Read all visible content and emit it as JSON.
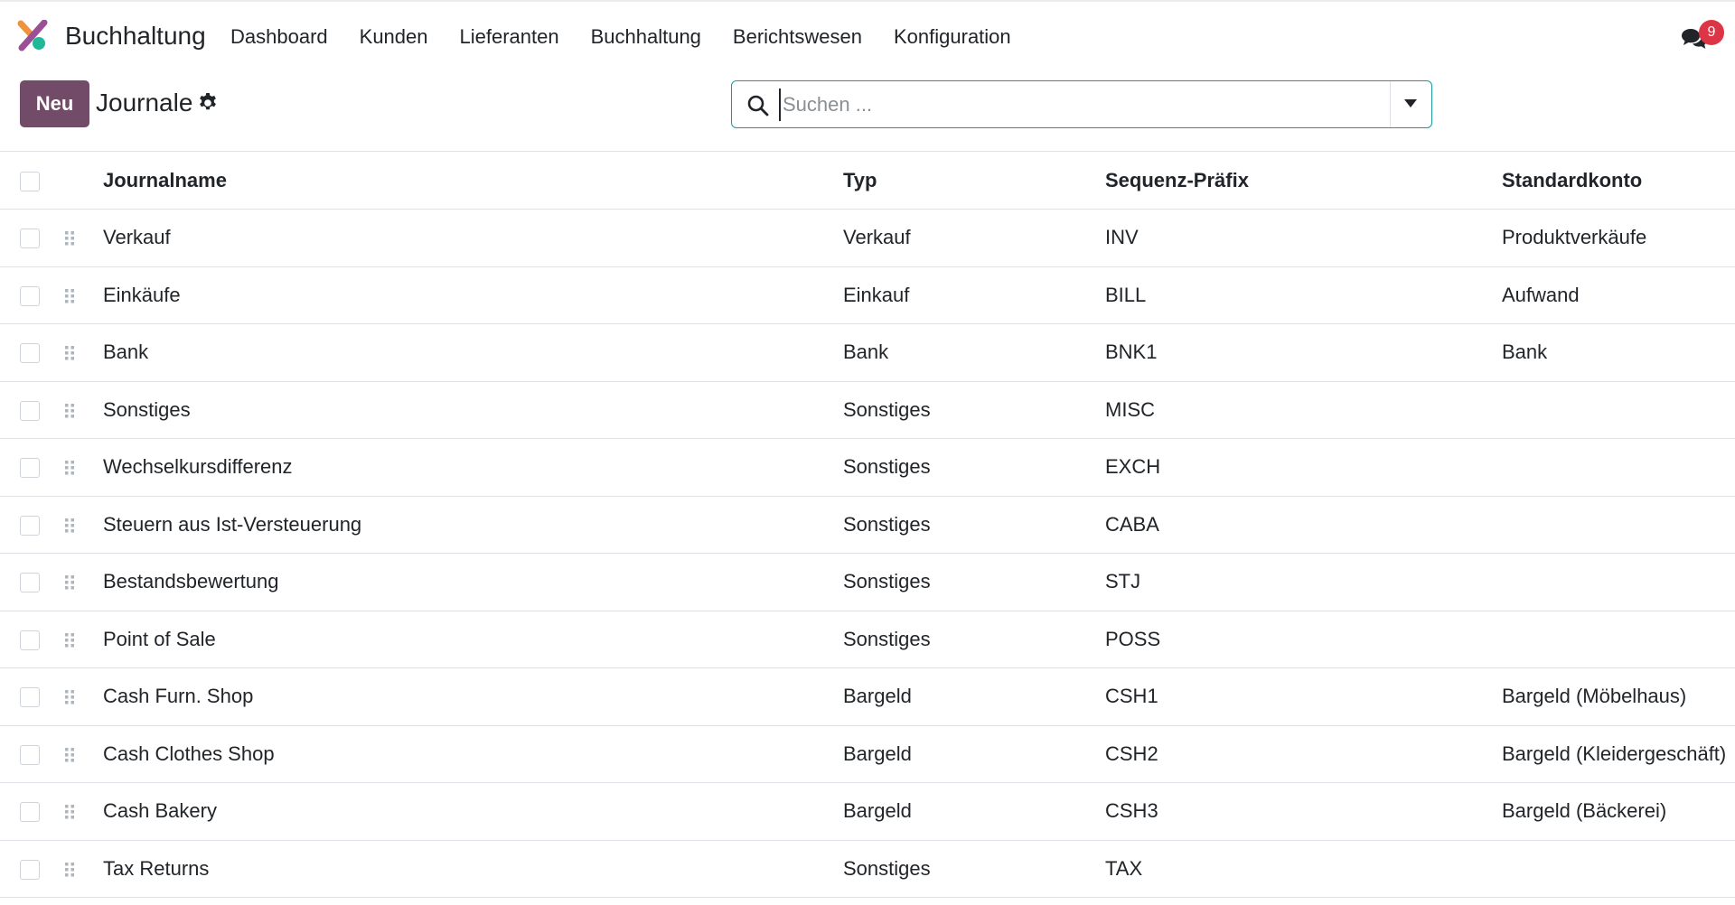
{
  "app": {
    "title": "Buchhaltung"
  },
  "menu": [
    {
      "label": "Dashboard"
    },
    {
      "label": "Kunden"
    },
    {
      "label": "Lieferanten"
    },
    {
      "label": "Buchhaltung"
    },
    {
      "label": "Berichtswesen"
    },
    {
      "label": "Konfiguration"
    }
  ],
  "messages": {
    "count": "9",
    "icon": "chat-icon"
  },
  "control": {
    "new_label": "Neu",
    "title": "Journale",
    "settings_icon": "gear-icon"
  },
  "search": {
    "placeholder": "Suchen ...",
    "value": ""
  },
  "table": {
    "columns": [
      "Journalname",
      "Typ",
      "Sequenz-Präfix",
      "Standardkonto"
    ],
    "rows": [
      {
        "name": "Verkauf",
        "type": "Verkauf",
        "prefix": "INV",
        "account": "Produktverkäufe"
      },
      {
        "name": "Einkäufe",
        "type": "Einkauf",
        "prefix": "BILL",
        "account": "Aufwand"
      },
      {
        "name": "Bank",
        "type": "Bank",
        "prefix": "BNK1",
        "account": "Bank"
      },
      {
        "name": "Sonstiges",
        "type": "Sonstiges",
        "prefix": "MISC",
        "account": ""
      },
      {
        "name": "Wechselkursdifferenz",
        "type": "Sonstiges",
        "prefix": "EXCH",
        "account": ""
      },
      {
        "name": "Steuern aus Ist-Versteuerung",
        "type": "Sonstiges",
        "prefix": "CABA",
        "account": ""
      },
      {
        "name": "Bestandsbewertung",
        "type": "Sonstiges",
        "prefix": "STJ",
        "account": ""
      },
      {
        "name": "Point of Sale",
        "type": "Sonstiges",
        "prefix": "POSS",
        "account": ""
      },
      {
        "name": "Cash Furn. Shop",
        "type": "Bargeld",
        "prefix": "CSH1",
        "account": "Bargeld (Möbelhaus)"
      },
      {
        "name": "Cash Clothes Shop",
        "type": "Bargeld",
        "prefix": "CSH2",
        "account": "Bargeld (Kleidergeschäft)"
      },
      {
        "name": "Cash Bakery",
        "type": "Bargeld",
        "prefix": "CSH3",
        "account": "Bargeld (Bäckerei)"
      },
      {
        "name": "Tax Returns",
        "type": "Sonstiges",
        "prefix": "TAX",
        "account": ""
      }
    ]
  },
  "colors": {
    "brand": "#714b67",
    "search_border": "#1a9a9e",
    "badge": "#dc3545"
  }
}
